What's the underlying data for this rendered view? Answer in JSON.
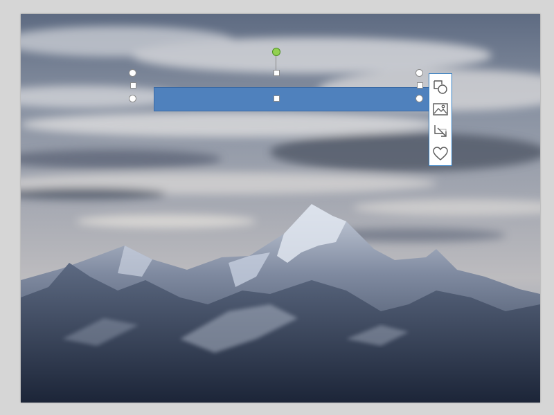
{
  "slide": {
    "background": "mountain-landscape-photo"
  },
  "selected_shape": {
    "kind": "rectangle",
    "fill_color": "#4f81bd",
    "outline_color": "#3a6aa5",
    "rotation_handle_color": "#92d050"
  },
  "quick_toolbar": {
    "accent_color": "#2f7cc1",
    "buttons": [
      {
        "icon": "layout-options-icon"
      },
      {
        "icon": "picture-icon"
      },
      {
        "icon": "crop-resize-icon"
      },
      {
        "icon": "heart-icon"
      }
    ]
  }
}
